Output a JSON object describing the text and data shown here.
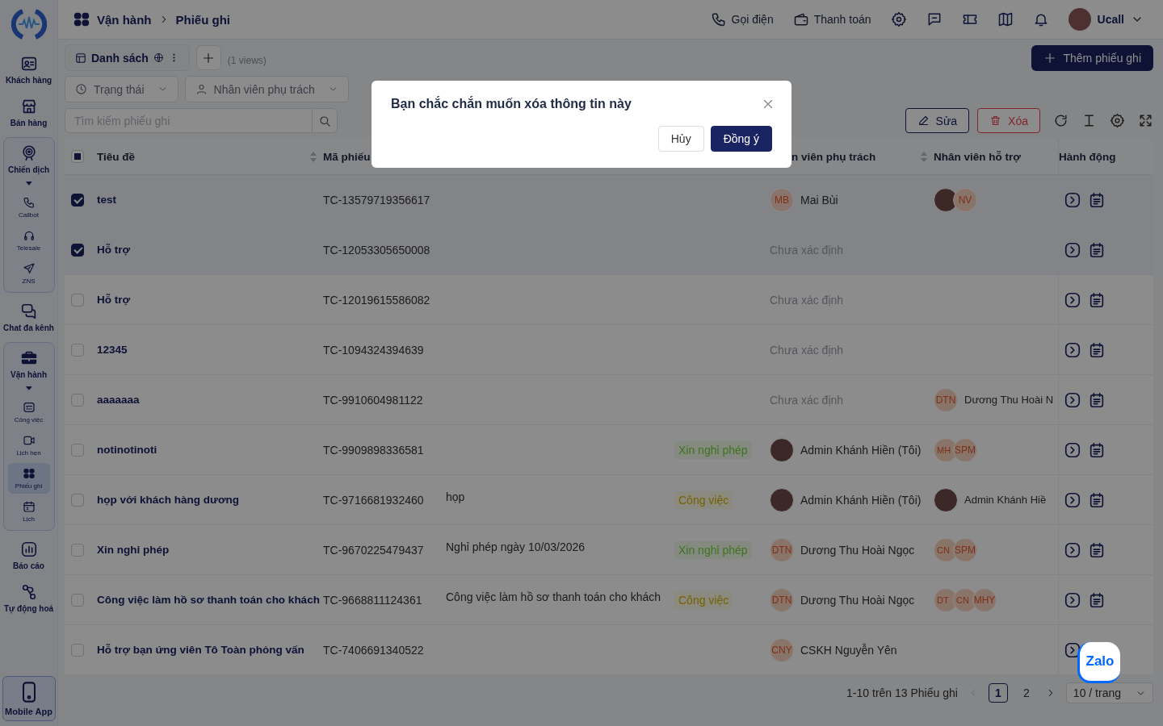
{
  "sidebar": {
    "items": [
      {
        "label": "Khách hàng",
        "selected": false
      },
      {
        "label": "Bán hàng",
        "selected": false
      },
      {
        "label": "Chiến dịch",
        "selected": false,
        "expanded": true,
        "children": [
          {
            "label": "Callbot",
            "selected": false
          },
          {
            "label": "Telesale",
            "selected": false
          },
          {
            "label": "ZNS",
            "selected": false
          }
        ]
      },
      {
        "label": "Chat đa kênh",
        "selected": false
      },
      {
        "label": "Vận hành",
        "selected": false,
        "expanded": true,
        "children": [
          {
            "label": "Công việc",
            "selected": false
          },
          {
            "label": "Lịch hẹn",
            "selected": false
          },
          {
            "label": "Phiếu ghi",
            "selected": true
          },
          {
            "label": "Lịch",
            "selected": false
          }
        ]
      },
      {
        "label": "Báo cáo",
        "selected": false
      },
      {
        "label": "Tự động hoá",
        "selected": false
      }
    ],
    "mobile_app": "Mobile App"
  },
  "topbar": {
    "breadcrumb": [
      "Vận hành",
      "Phiếu ghi"
    ],
    "actions": [
      "Gọi điện",
      "Thanh toán"
    ],
    "user": "Ucall"
  },
  "toolbar": {
    "view_tab": "Danh sách",
    "views_count": "(1 views)",
    "add_button": "Thêm phiếu ghi",
    "filters": [
      "Trạng thái",
      "Nhân viên phụ trách"
    ],
    "search": {
      "placeholder": "Tìm kiếm phiếu ghi"
    },
    "edit_button": "Sửa",
    "delete_button": "Xóa"
  },
  "table": {
    "select_all": {
      "checked": false,
      "indeterminate": true
    },
    "columns": [
      {
        "label": "Tiêu đề",
        "sortable": true
      },
      {
        "label": "Mã phiếu",
        "sortable": false
      },
      {
        "label": "n viên phụ trách",
        "sortable": true
      },
      {
        "label": "Nhân viên hỗ trợ",
        "sortable": false
      },
      {
        "label": "Hành động",
        "sortable": false
      }
    ],
    "rows": [
      {
        "selected": true,
        "title": "test",
        "code": "TC-13579719356617",
        "assignee": {
          "kind": "initials",
          "initials": "MB",
          "name": "Mai Bùi"
        },
        "supporters": [
          {
            "kind": "photo"
          },
          {
            "kind": "initials",
            "initials": "NV"
          }
        ]
      },
      {
        "selected": true,
        "title": "Hỗ trợ",
        "code": "TC-12053305650008",
        "assignee": {
          "kind": "unset",
          "name": "Chưa xác định"
        }
      },
      {
        "selected": false,
        "title": "Hỗ trợ",
        "code": "TC-12019615586082",
        "assignee": {
          "kind": "unset",
          "name": "Chưa xác định"
        }
      },
      {
        "selected": false,
        "title": "12345",
        "code": "TC-1094324394639",
        "assignee": {
          "kind": "unset",
          "name": "Chưa xác định"
        }
      },
      {
        "selected": false,
        "title": "aaaaaaa",
        "code": "TC-9910604981122",
        "assignee": {
          "kind": "unset",
          "name": "Chưa xác định"
        },
        "supporters": [
          {
            "kind": "initials",
            "initials": "DTN",
            "name": "Dương Thu Hoài N"
          }
        ]
      },
      {
        "selected": false,
        "title": "notinotinoti",
        "code": "TC-9909898336581",
        "tag": {
          "label": "Xin nghỉ phép",
          "kind": "leave"
        },
        "assignee": {
          "kind": "photo",
          "name": "Admin Khánh Hiền (Tôi)"
        },
        "supporters": [
          {
            "kind": "initials",
            "initials": "MH"
          },
          {
            "kind": "initials",
            "initials": "SPM"
          }
        ]
      },
      {
        "selected": false,
        "title": "họp với khách hàng dương",
        "code": "TC-9716681932460",
        "description": "họp",
        "tag": {
          "label": "Công việc",
          "kind": "task"
        },
        "assignee": {
          "kind": "photo",
          "name": "Admin Khánh Hiền (Tôi)"
        },
        "supporters": [
          {
            "kind": "photo",
            "name": "Admin Khánh Hiề"
          }
        ]
      },
      {
        "selected": false,
        "title": "Xin nghỉ phép",
        "code": "TC-9670225479437",
        "description": "Nghỉ phép ngày 10/03/2026",
        "tag": {
          "label": "Xin nghỉ phép",
          "kind": "leave"
        },
        "assignee": {
          "kind": "initials",
          "initials": "DTN",
          "name": "Dương Thu Hoài Ngọc"
        },
        "supporters": [
          {
            "kind": "initials",
            "initials": "CN"
          },
          {
            "kind": "initials",
            "initials": "SPM"
          }
        ]
      },
      {
        "selected": false,
        "title": "Công việc làm hồ sơ thanh toán cho khách",
        "code": "TC-9668811124361",
        "description": "Công việc làm hồ sơ thanh toán cho khách",
        "tag": {
          "label": "Công việc",
          "kind": "task"
        },
        "assignee": {
          "kind": "initials",
          "initials": "DTN",
          "name": "Dương Thu Hoài Ngọc"
        },
        "supporters": [
          {
            "kind": "initials",
            "initials": "DT"
          },
          {
            "kind": "initials",
            "initials": "CN"
          },
          {
            "kind": "initials",
            "initials": "MHY"
          }
        ]
      },
      {
        "selected": false,
        "title": "Hỗ trợ bạn ứng viên Tô Toàn phỏng vấn",
        "code": "TC-7406691340522",
        "assignee": {
          "kind": "initials",
          "initials": "CNY",
          "name": "CSKH Nguyễn Yên"
        }
      }
    ]
  },
  "pagination": {
    "summary": "1-10 trên 13 Phiếu ghi",
    "prev_disabled": true,
    "pages": [
      {
        "label": "1",
        "selected": true
      },
      {
        "label": "2",
        "selected": false
      }
    ],
    "page_size": "10 / trang"
  },
  "dialog": {
    "title": "Bạn chắc chắn muốn xóa thông tin này",
    "cancel": "Hủy",
    "confirm": "Đồng ý"
  },
  "chat_widget": {
    "label": "Zalo"
  }
}
